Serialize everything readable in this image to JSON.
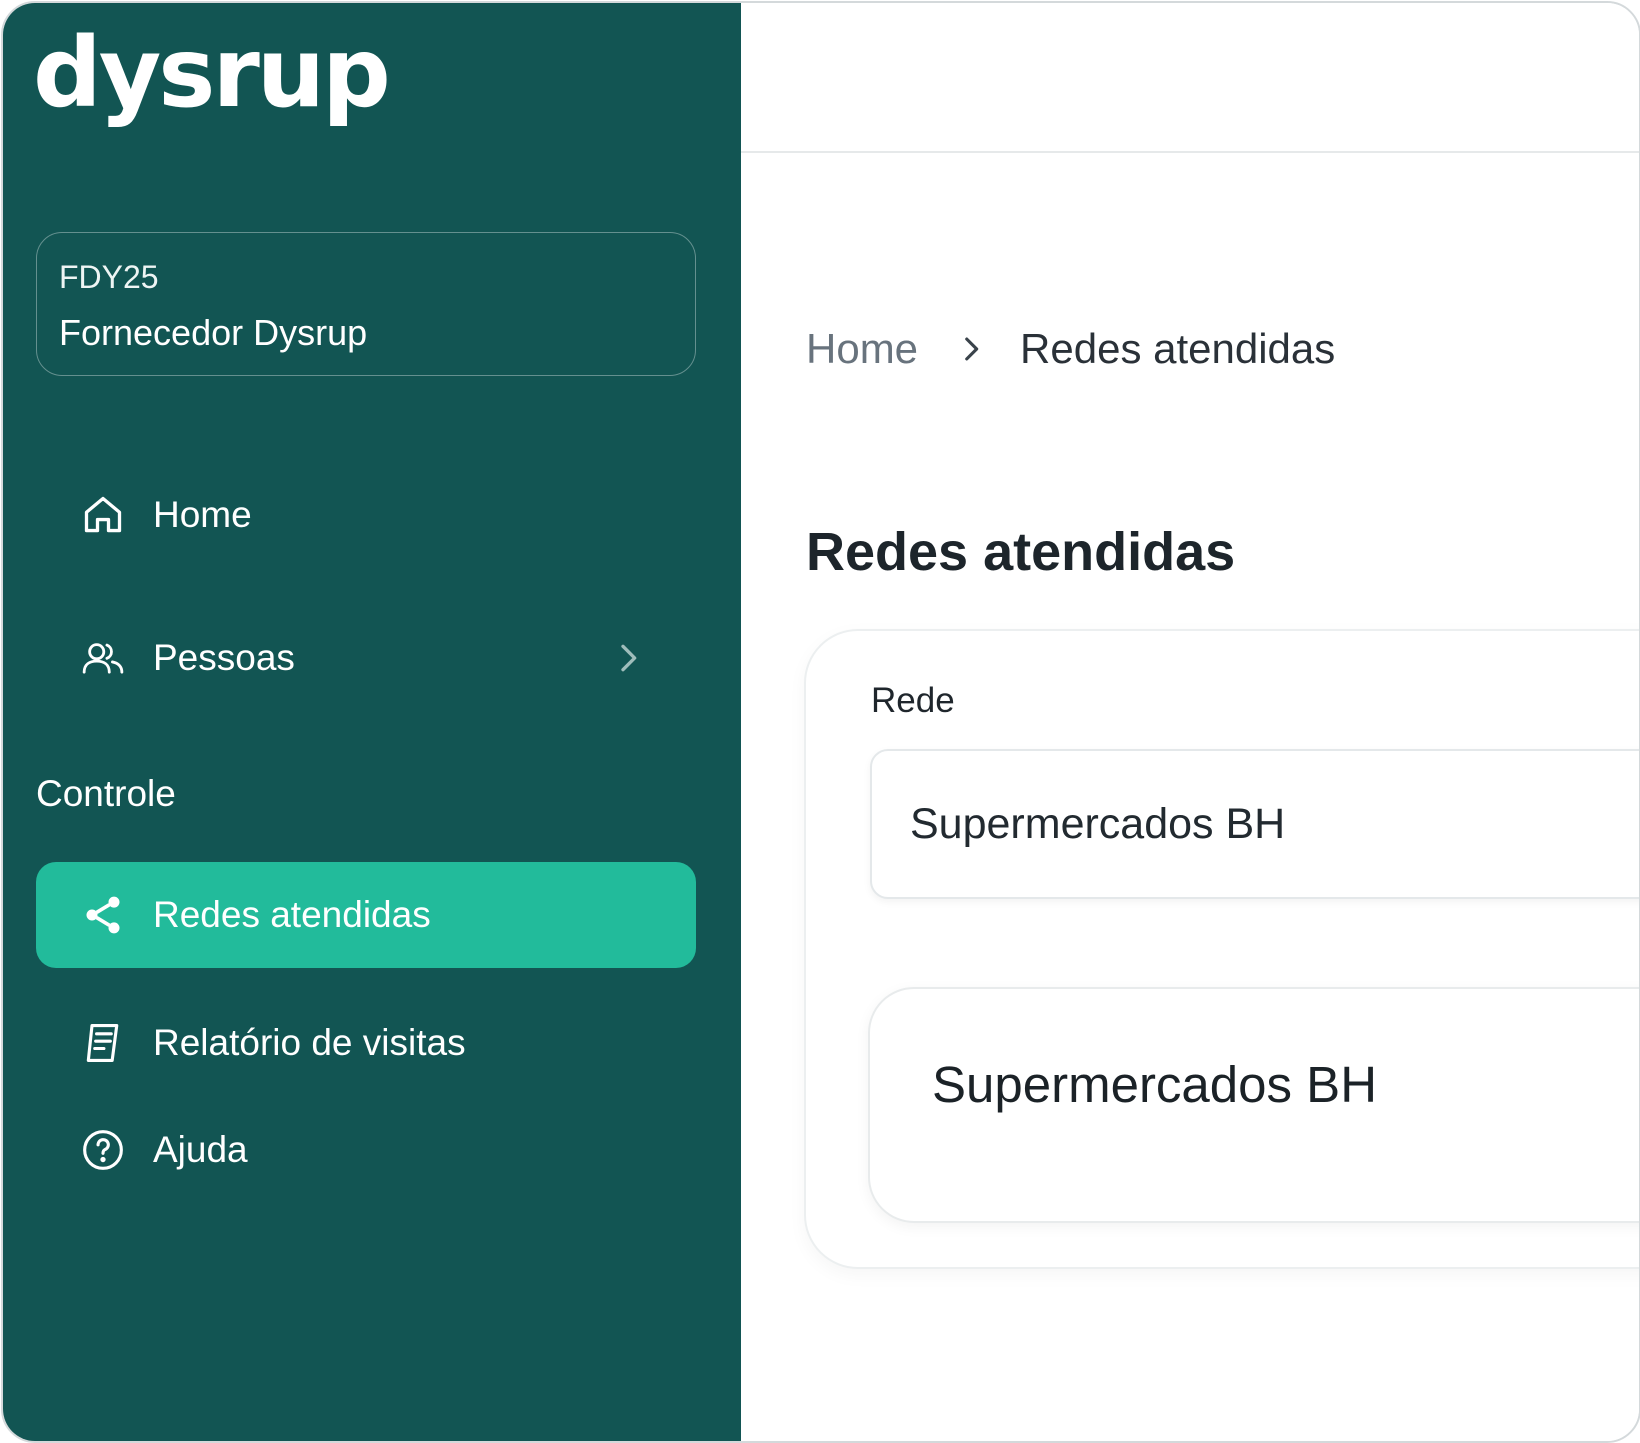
{
  "brand": {
    "logo_text": "dysrup",
    "primary_color": "#125553",
    "accent_color": "#22bb9b"
  },
  "account": {
    "code": "FDY25",
    "name": "Fornecedor Dysrup"
  },
  "sidebar": {
    "items": [
      {
        "label": "Home",
        "icon": "home-icon"
      },
      {
        "label": "Pessoas",
        "icon": "people-icon",
        "has_submenu": true
      }
    ],
    "section_label": "Controle",
    "control_items": [
      {
        "label": "Redes atendidas",
        "icon": "share-icon",
        "active": true
      },
      {
        "label": "Relatório de visitas",
        "icon": "report-icon"
      },
      {
        "label": "Ajuda",
        "icon": "help-icon"
      }
    ]
  },
  "breadcrumb": {
    "home": "Home",
    "current": "Redes atendidas"
  },
  "page": {
    "title": "Redes atendidas"
  },
  "filter": {
    "label": "Rede",
    "selected": "Supermercados BH"
  },
  "results": [
    {
      "name": "Supermercados BH"
    }
  ]
}
